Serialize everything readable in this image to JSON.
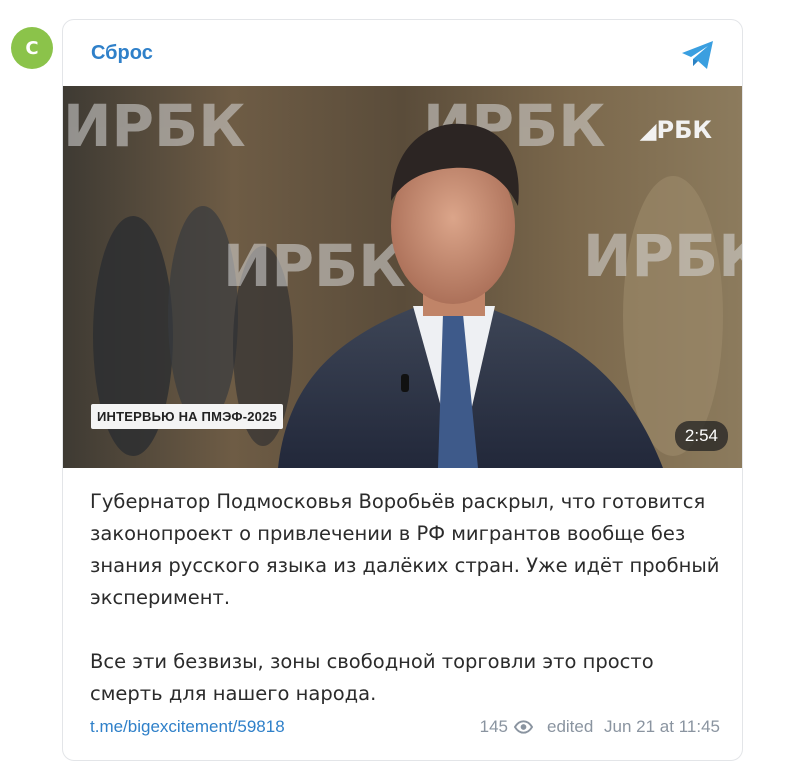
{
  "avatar": {
    "letter": "С",
    "color": "#8bc34a"
  },
  "channel": {
    "name": "Сброс"
  },
  "header_icon": "telegram-plane-icon",
  "media": {
    "overlay_logo": "РБК",
    "badge": "ИНТЕРВЬЮ НА ПМЭФ-2025",
    "duration": "2:54"
  },
  "post": {
    "paragraphs": [
      "Губернатор Подмосковья Воробьёв раскрыл, что готовится законопроект о привлечении в РФ мигрантов вообще без знания русского языка из далёких стран. Уже идёт пробный эксперимент.",
      "Все эти безвизы, зоны свободной торговли это просто смерть для нашего народа."
    ]
  },
  "footer": {
    "link": "t.me/bigexcitement/59818",
    "views": "145",
    "views_icon": "eye-icon",
    "edited_label": "edited",
    "date": "Jun 21 at 11:45"
  },
  "colors": {
    "accent": "#2f80c9",
    "muted": "#8a94a0"
  }
}
